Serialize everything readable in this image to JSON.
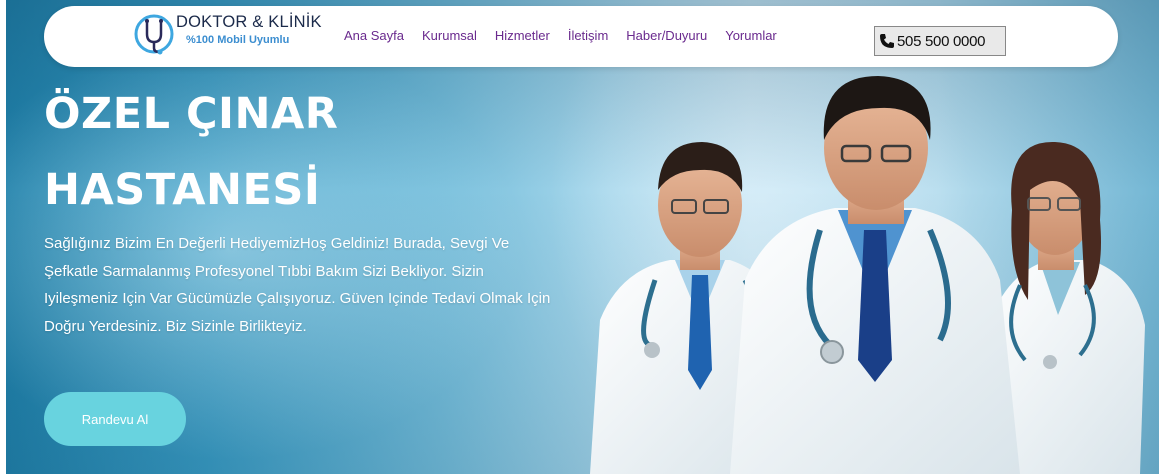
{
  "nav": {
    "logo_title": "DOKTOR & KLİNİK",
    "logo_subtitle": "%100 Mobil Uyumlu",
    "items": [
      {
        "label": "Ana Sayfa"
      },
      {
        "label": "Kurumsal"
      },
      {
        "label": "Hizmetler"
      },
      {
        "label": "İletişim"
      },
      {
        "label": "Haber/Duyuru"
      },
      {
        "label": "Yorumlar"
      }
    ],
    "phone": "505 500 0000",
    "menu_color": "#6a2a8e"
  },
  "hero": {
    "title_line1": "ÖZEL ÇINAR",
    "title_line2": "HASTANESİ",
    "description": "Sağlığınız Bizim En Değerli HediyemizHoş Geldiniz! Burada, Sevgi Ve Şefkatle Sarmalanmış Profesyonel Tıbbi Bakım Sizi Bekliyor. Sizin Iyileşmeniz Için Var Gücümüzle Çalışıyoruz. Güven Içinde Tedavi Olmak Için Doğru Yerdesiniz. Biz Sizinle Birlikteyiz.",
    "cta_label": "Randevu Al",
    "cta_color": "#68d3df"
  },
  "icons": {
    "logo": "stethoscope-logo-icon",
    "phone": "phone-icon"
  }
}
